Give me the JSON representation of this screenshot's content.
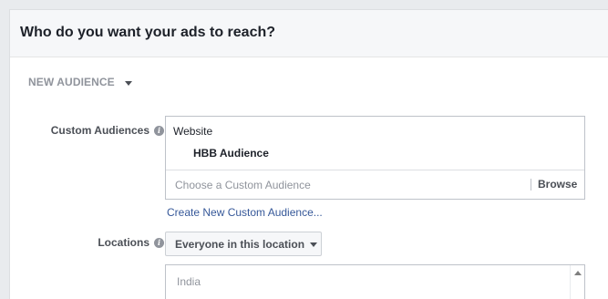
{
  "panel": {
    "title": "Who do you want your ads to reach?"
  },
  "audience_selector": {
    "label": "NEW AUDIENCE"
  },
  "custom_audiences": {
    "label": "Custom Audiences",
    "info_icon": "info-icon",
    "groups": [
      {
        "title": "Website",
        "items": [
          "HBB Audience"
        ]
      }
    ],
    "input_placeholder": "Choose a Custom Audience",
    "browse_label": "Browse",
    "create_link": "Create New Custom Audience..."
  },
  "locations": {
    "label": "Locations",
    "info_icon": "info-icon",
    "select_value": "Everyone in this location",
    "items": [
      "India"
    ]
  },
  "colors": {
    "page_bg": "#e9ebee",
    "header_bg": "#f6f7f9",
    "link": "#365899",
    "text": "#1d2129",
    "muted": "#90949c"
  }
}
